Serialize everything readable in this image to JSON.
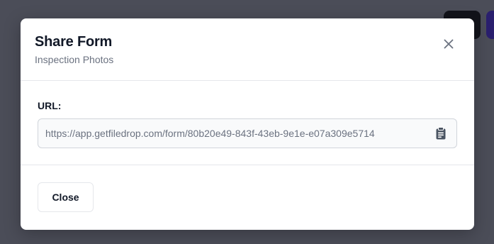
{
  "modal": {
    "title": "Share Form",
    "subtitle": "Inspection Photos",
    "close_icon": "close-icon"
  },
  "url_section": {
    "label": "URL:",
    "value": "https://app.getfiledrop.com/form/80b20e49-843f-43eb-9e1e-e07a309e5714",
    "copy_icon": "clipboard-icon"
  },
  "footer": {
    "close_label": "Close"
  },
  "colors": {
    "overlay": "#4b4d58",
    "modal_bg": "#ffffff",
    "title": "#111827",
    "muted": "#6b7280",
    "border": "#e5e7eb",
    "input_bg": "#f9fafb"
  }
}
